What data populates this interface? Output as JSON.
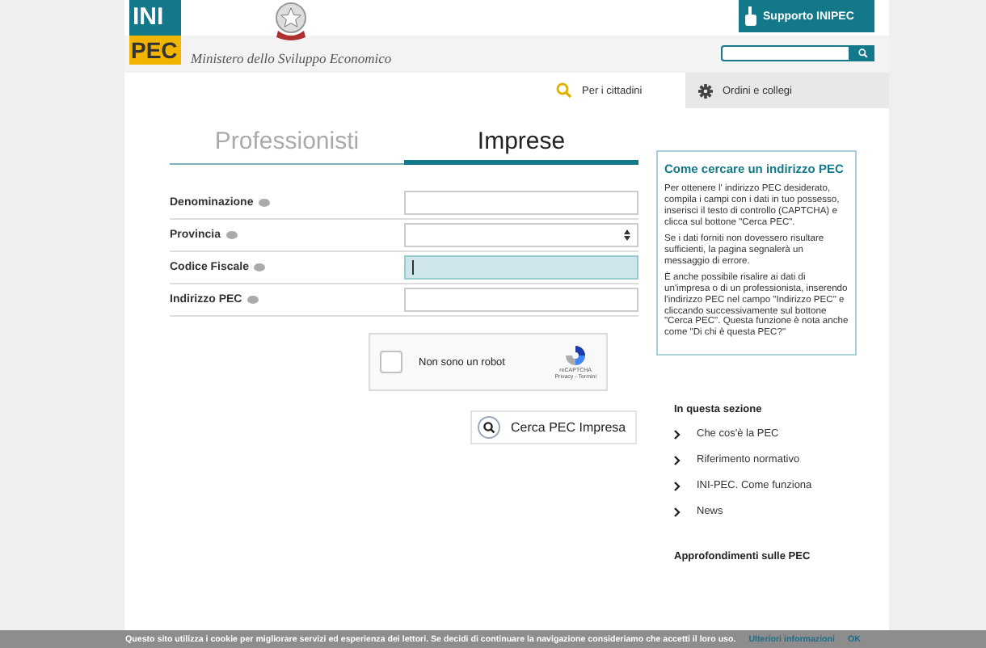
{
  "header": {
    "logo": {
      "top": "INI",
      "bottom": "PEC"
    },
    "ministry": "Ministero dello Sviluppo Economico",
    "support_button": "Supporto INIPEC"
  },
  "nav": [
    {
      "label": "Per i cittadini",
      "selected": true,
      "kind": "search"
    },
    {
      "label": "Ordini e collegi",
      "selected": false,
      "kind": "gear"
    }
  ],
  "tabs": [
    {
      "label": "Professionisti",
      "selected": false
    },
    {
      "label": "Imprese",
      "selected": true
    }
  ],
  "form": [
    {
      "label": "Denominazione",
      "kind": "text",
      "focused": false
    },
    {
      "label": "Provincia",
      "kind": "select",
      "focused": false
    },
    {
      "label": "Codice Fiscale",
      "kind": "text",
      "focused": true
    },
    {
      "label": "Indirizzo PEC",
      "kind": "text",
      "focused": false
    }
  ],
  "captcha": {
    "label": "Non sono un robot",
    "checked": false,
    "brand": "reCAPTCHA",
    "links": "Privacy - Termini"
  },
  "search_button": "Cerca PEC Impresa",
  "info_box": {
    "title": "Come cercare un indirizzo PEC",
    "paragraphs": [
      "Per ottenere l' indirizzo PEC desiderato, compila i campi con i dati in tuo possesso, inserisci il testo di controllo (CAPTCHA) e clicca sul bottone \"Cerca PEC\".",
      "Se i dati forniti non dovessero risultare sufficienti, la pagina segnalerà un messaggio di errore.",
      "È anche possibile risalire ai dati di un'impresa o di un professionista, inserendo l'indirizzo PEC nel campo \"Indirizzo PEC\" e cliccando successivamente  sul bottone \"Cerca PEC\". Questa funzione è nota anche come \"Di chi è questa PEC?\""
    ]
  },
  "section": {
    "title": "In questa sezione",
    "items": [
      "Che cos'è la PEC",
      "Riferimento normativo",
      "INI-PEC. Come funziona",
      "News"
    ]
  },
  "more_heading": "Approfondimenti sulle PEC",
  "cookie_bar": {
    "text": "Questo sito utilizza i cookie per migliorare servizi ed esperienza dei lettori. Se decidi di continuare la navigazione consideriamo che accetti il loro uso.",
    "link": "Ulteriori informazioni",
    "ok": "OK"
  }
}
